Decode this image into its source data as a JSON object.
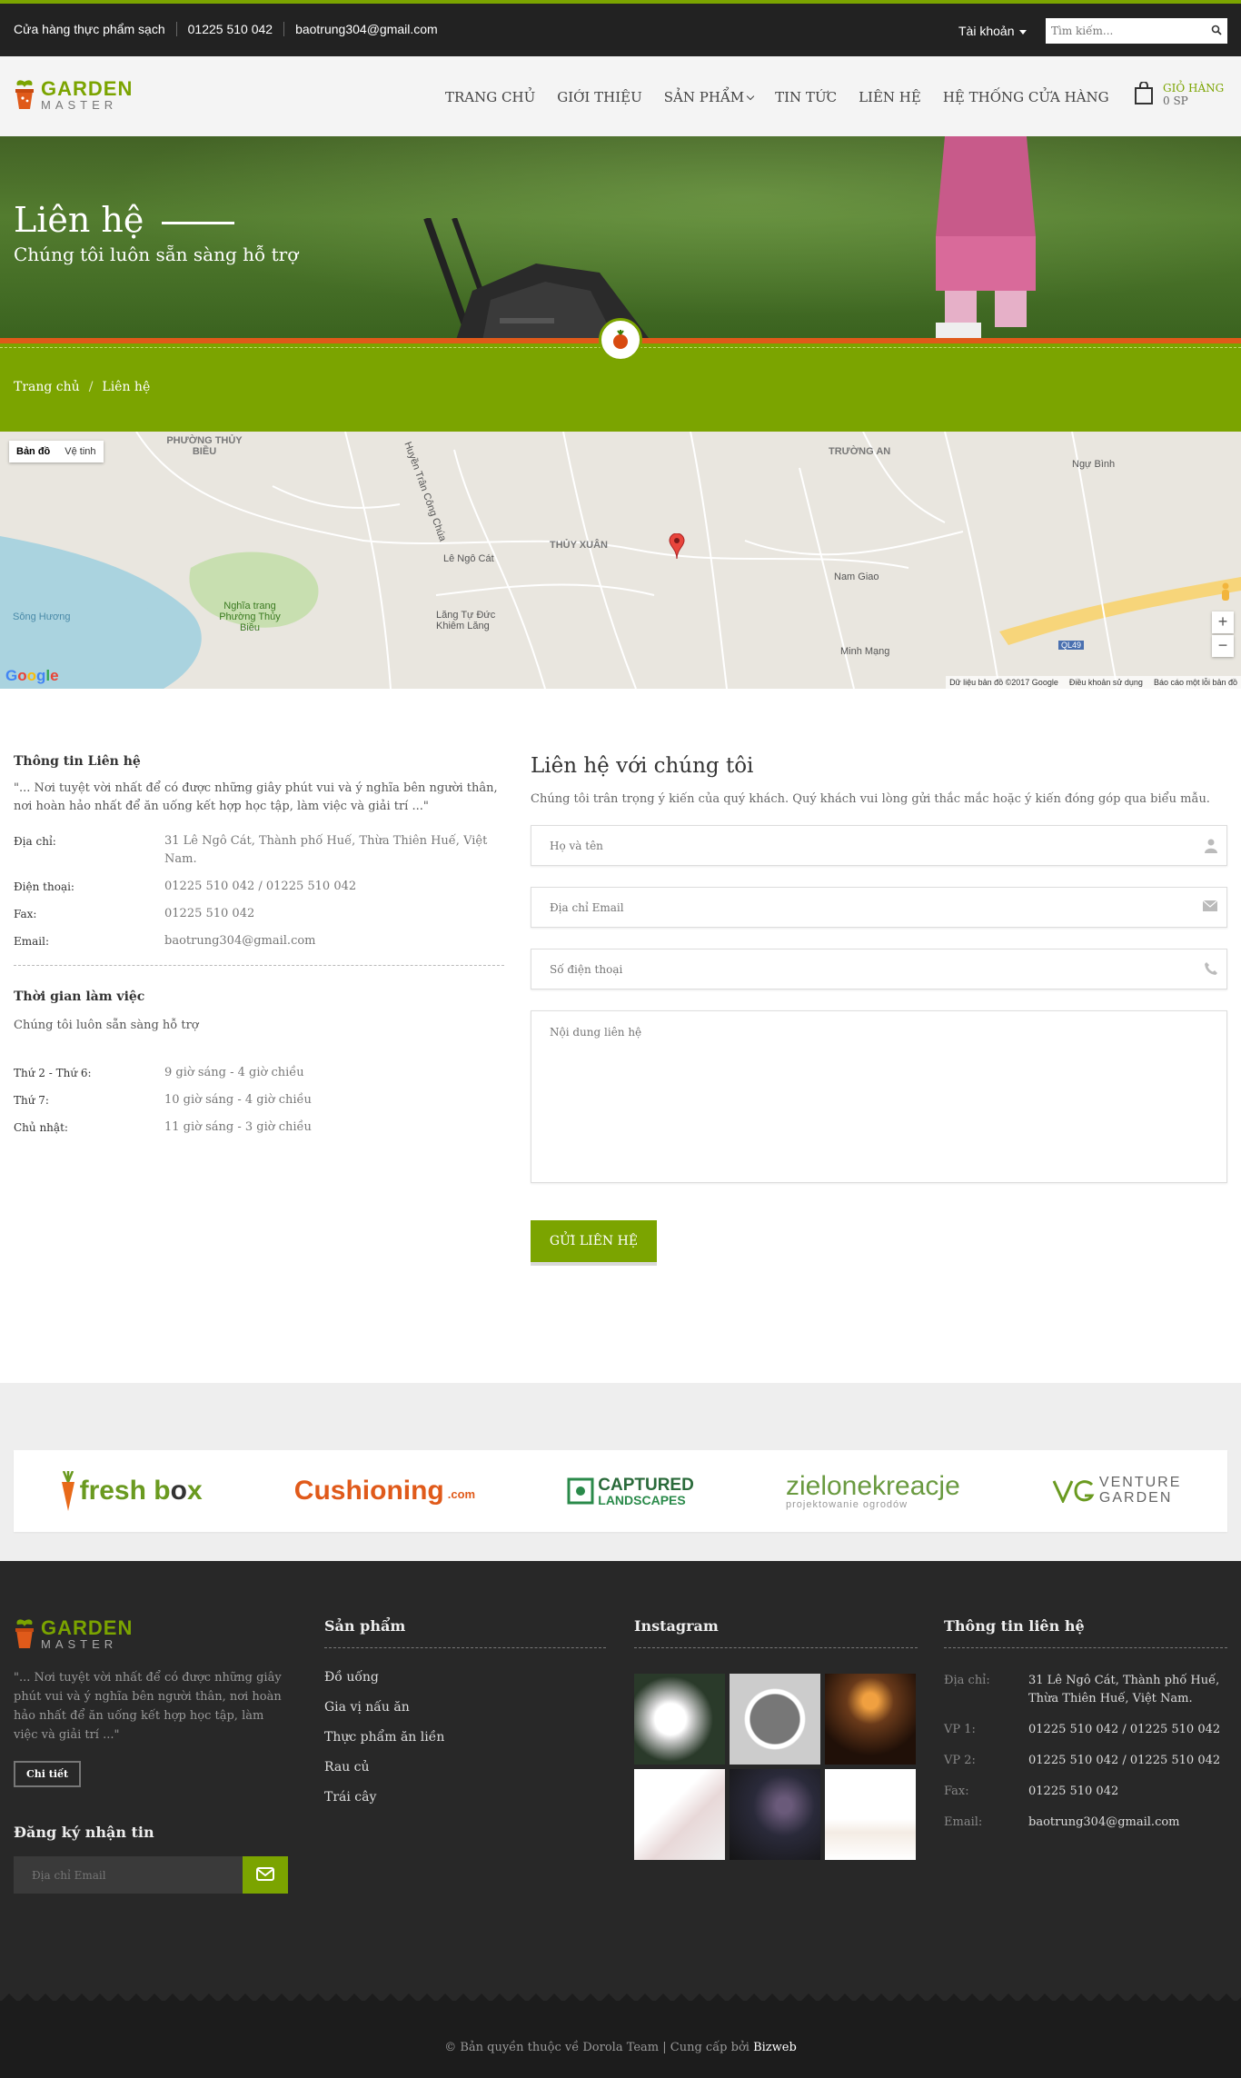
{
  "topbar": {
    "store": "Cửa hàng thực phẩm sạch",
    "phone": "01225 510 042",
    "email": "baotrung304@gmail.com",
    "account": "Tài khoản",
    "search_placeholder": "Tìm kiếm..."
  },
  "logo": {
    "line1": "GARDEN",
    "line2": "MASTER"
  },
  "nav": [
    "TRANG CHỦ",
    "GIỚI THIỆU",
    "SẢN PHẨM",
    "TIN TỨC",
    "LIÊN HỆ",
    "HỆ THỐNG CỬA HÀNG"
  ],
  "cart": {
    "label": "GIỎ HÀNG",
    "count": "0 SP"
  },
  "hero": {
    "title": "Liên hệ",
    "subtitle": "Chúng tôi luôn sẵn sàng hỗ trợ"
  },
  "breadcrumb": {
    "home": "Trang chủ",
    "sep": "/",
    "current": "Liên hệ"
  },
  "map": {
    "type_map": "Bản đồ",
    "type_sat": "Vệ tinh",
    "labels": [
      "PHƯỜNG THỦY BIỀU",
      "THỦY XUÂN",
      "TRƯỜNG AN",
      "Lê Ngô Cát",
      "Nghĩa trang Phường Thủy Biều",
      "Lăng Tự Đức Khiêm Lăng",
      "Sông Hương",
      "Nam Giao",
      "Minh Mạng",
      "Huyền Trân Công Chúa",
      "Ngự Bình",
      "QL49"
    ],
    "zoom_in": "+",
    "zoom_out": "−",
    "footer": [
      "Dữ liệu bản đồ ©2017 Google",
      "Điều khoản sử dụng",
      "Báo cáo một lỗi bản đồ"
    ],
    "google": "Google"
  },
  "info": {
    "title": "Thông tin Liên hệ",
    "quote": "\"... Nơi tuyệt vời nhất để có được những giây phút vui và ý nghĩa bên người thân, nơi hoàn hảo nhất để ăn uống kết hợp học tập, làm việc và giải trí ...\"",
    "rows": [
      {
        "k": "Địa chỉ:",
        "v": "31 Lê Ngô Cát, Thành phố Huế, Thừa Thiên Huế, Việt Nam."
      },
      {
        "k": "Điện thoại:",
        "v": "01225 510 042 / 01225 510 042"
      },
      {
        "k": "Fax:",
        "v": "01225 510 042"
      },
      {
        "k": "Email:",
        "v": "baotrung304@gmail.com"
      }
    ],
    "hours_title": "Thời gian làm việc",
    "hours_sub": "Chúng tôi luôn sẵn sàng hỗ trợ",
    "hours": [
      {
        "k": "Thứ 2 - Thứ 6:",
        "v": "9 giờ sáng - 4 giờ chiều"
      },
      {
        "k": "Thứ 7:",
        "v": "10 giờ sáng - 4 giờ chiều"
      },
      {
        "k": "Chủ nhật:",
        "v": "11 giờ sáng - 3 giờ chiều"
      }
    ]
  },
  "form": {
    "title": "Liên hệ với chúng tôi",
    "intro": "Chúng tôi trân trọng ý kiến của quý khách. Quý khách vui lòng gửi thắc mắc hoặc ý kiến đóng góp qua biểu mẫu.",
    "name_ph": "Họ và tên",
    "email_ph": "Địa chỉ Email",
    "phone_ph": "Số điện thoại",
    "msg_ph": "Nội dung liên hệ",
    "submit": "GỬI LIÊN HỆ"
  },
  "partners": [
    {
      "a": "fresh b",
      "b": "x"
    },
    {
      "a": "Cushioning",
      "b": ".com"
    },
    {
      "a": "CAPTURED",
      "b": "LANDSCAPES"
    },
    {
      "a": "zielonekreacje",
      "b": "projektowanie ogrodów"
    },
    {
      "a": "VENTURE",
      "b": "GARDEN"
    }
  ],
  "footer": {
    "quote": "\"... Nơi tuyệt vời nhất để có được những giây phút vui và ý nghĩa bên người thân, nơi hoàn hảo nhất để ăn uống kết hợp học tập, làm việc và giải trí ...\"",
    "more": "Chi tiết",
    "newsletter": "Đăng ký nhận tin",
    "newsletter_ph": "Địa chỉ Email",
    "products_title": "Sản phẩm",
    "products": [
      "Đồ uống",
      "Gia vị nấu ăn",
      "Thực phẩm ăn liền",
      "Rau củ",
      "Trái cây"
    ],
    "instagram_title": "Instagram",
    "contact_title": "Thông tin liên hệ",
    "contact": [
      {
        "k": "Địa chỉ:",
        "v": "31 Lê Ngô Cát, Thành phố Huế, Thừa Thiên Huế, Việt Nam."
      },
      {
        "k": "VP 1:",
        "v": "01225 510 042 / 01225 510 042"
      },
      {
        "k": "VP 2:",
        "v": "01225 510 042 / 01225 510 042"
      },
      {
        "k": "Fax:",
        "v": "01225 510 042"
      },
      {
        "k": "Email:",
        "v": "baotrung304@gmail.com"
      }
    ]
  },
  "copyright": {
    "text": "© Bản quyền thuộc về Dorola Team | Cung cấp bởi ",
    "brand": "Bizweb"
  },
  "colors": {
    "accent": "#7ba400",
    "orange": "#e05a1a",
    "dark": "#222222"
  }
}
